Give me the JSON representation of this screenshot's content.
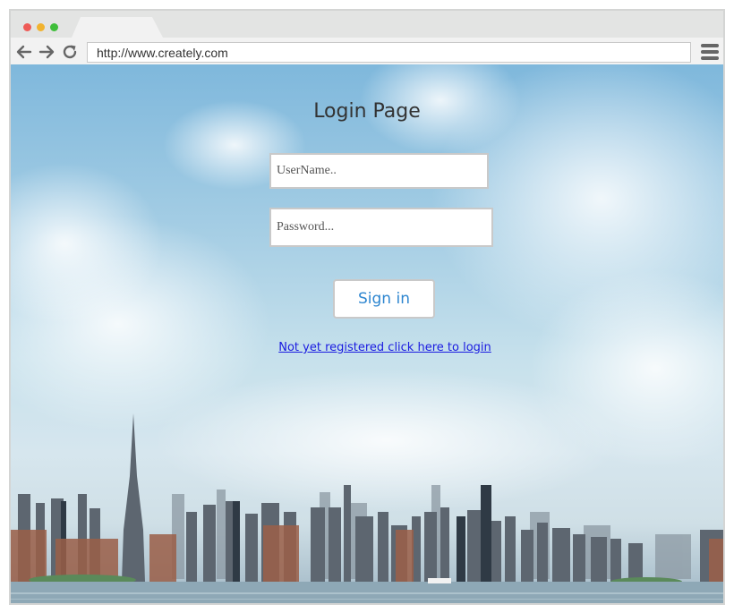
{
  "browser": {
    "url": "http://www.creately.com",
    "controls": {
      "back_icon": "arrow-left-icon",
      "forward_icon": "arrow-right-icon",
      "reload_icon": "reload-icon",
      "menu_icon": "hamburger-menu-icon"
    }
  },
  "login": {
    "title": "Login Page",
    "username_placeholder": "UserName..",
    "password_placeholder": "Password...",
    "signin_label": "Sign in",
    "register_link": "Not yet registered click here to login"
  },
  "colors": {
    "sky_top": "#7fb8dc",
    "link": "#1a1ae0",
    "signin_text": "#2e86d0"
  }
}
